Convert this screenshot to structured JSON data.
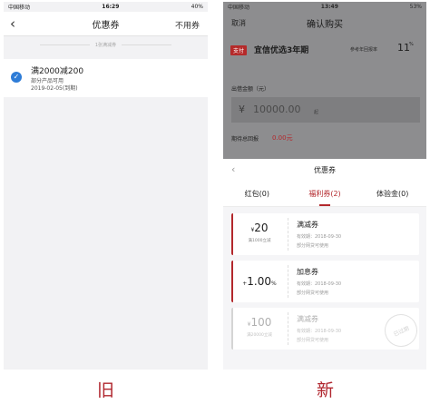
{
  "old_screen": {
    "status_bar": {
      "carrier": "中国移动",
      "time": "16:29",
      "battery": "40%"
    },
    "nav": {
      "title": "优惠券",
      "right_action": "不用券"
    },
    "count_label": "1张满减券",
    "coupon": {
      "title": "满2000减200",
      "scope": "部分产品可用",
      "expiry": "2019-02-05(到期)"
    },
    "caption": "旧"
  },
  "new_screen": {
    "status_bar": {
      "carrier": "中国移动",
      "time": "13:49",
      "battery": "53%"
    },
    "nav": {
      "title": "确认购买",
      "cancel_label": "取消"
    },
    "product": {
      "badge": "支付",
      "name": "宜信优选3年期",
      "yield_label": "参考年回报率",
      "yield_value": "11",
      "yield_unit": "%"
    },
    "amount": {
      "label": "出借金额（元）",
      "currency": "¥",
      "placeholder": "10000.00",
      "placeholder_suffix": "起"
    },
    "total_return": {
      "label": "期待总回报",
      "value": "0.00元"
    },
    "sheet": {
      "title": "优惠券",
      "tabs": [
        {
          "label": "红包(0)",
          "active": false
        },
        {
          "label": "福利券(2)",
          "active": true
        },
        {
          "label": "体验金(0)",
          "active": false
        }
      ],
      "coupons": [
        {
          "symbol": "¥",
          "value": "20",
          "suffix": "",
          "condition": "满1000立减",
          "name": "满减券",
          "validity": "有效期：2018-09-30",
          "scope": "部分网贷可使用",
          "expired": false
        },
        {
          "symbol": "+",
          "value": "1.00",
          "suffix": "%",
          "condition": "",
          "name": "加息券",
          "validity": "有效期：2018-09-30",
          "scope": "部分网贷可使用",
          "expired": false
        },
        {
          "symbol": "¥",
          "value": "100",
          "suffix": "",
          "condition": "满20000立减",
          "name": "满减券",
          "validity": "有效期：2018-09-30",
          "scope": "部分网贷可使用",
          "expired": true,
          "stamp": "已过期"
        }
      ]
    },
    "caption": "新"
  },
  "colors": {
    "accent_red": "#b3282c",
    "check_blue": "#2d7cd7",
    "overlay_gray": "#8d8d8f"
  },
  "icons": [
    "back-chevron-icon",
    "signal-icon",
    "wifi-icon",
    "battery-icon",
    "check-circle-icon"
  ]
}
